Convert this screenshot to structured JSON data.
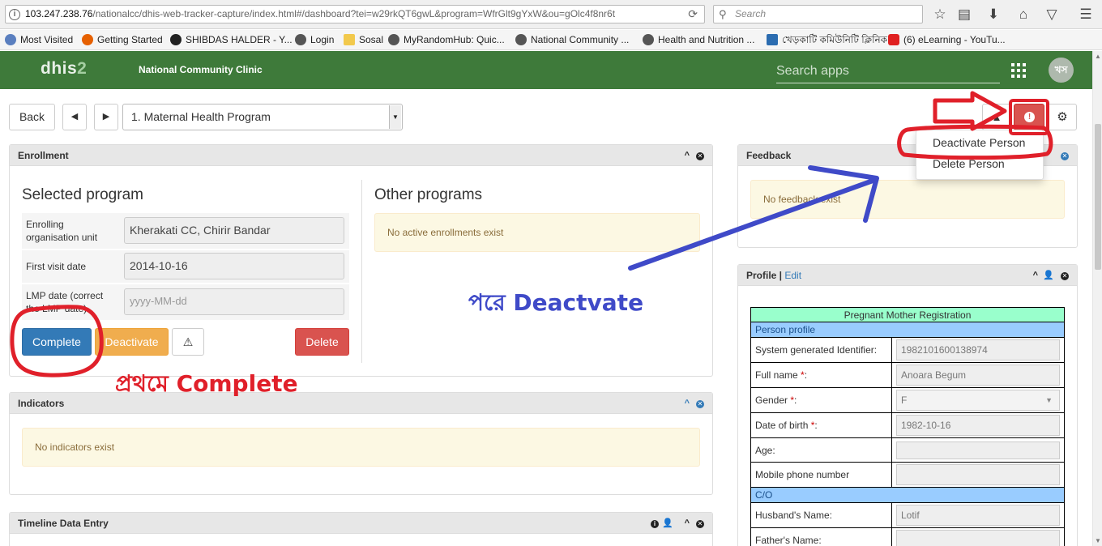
{
  "browser": {
    "url_host": "103.247.238.76",
    "url_path": "/nationalcc/dhis-web-tracker-capture/index.html#/dashboard?tei=w29rkQT6gwL&program=WfrGlt9gYxW&ou=gOlc4f8nr6t",
    "search_placeholder": "Search",
    "bookmarks": [
      {
        "label": "Most Visited",
        "icon_color": "#5a7fbf"
      },
      {
        "label": "Getting Started",
        "icon_color": "#e66000"
      },
      {
        "label": "SHIBDAS HALDER - Y...",
        "icon_color": "#222222"
      },
      {
        "label": "Login",
        "icon_color": "#555555"
      },
      {
        "label": "Sosal",
        "icon_color": "#f2c94c"
      },
      {
        "label": "MyRandomHub: Quic...",
        "icon_color": "#555555"
      },
      {
        "label": "National Community ...",
        "icon_color": "#555555"
      },
      {
        "label": "Health and Nutrition ...",
        "icon_color": "#555555"
      },
      {
        "label": "খেড়কাটি কমিউনিটি ক্লিনিক",
        "icon_color": "#2b6cb0"
      },
      {
        "label": "(6) eLearning - YouTu...",
        "icon_color": "#e02020"
      }
    ]
  },
  "header": {
    "logo_main": "dhis",
    "logo_num": "2",
    "org_name": "National Community Clinic",
    "search_placeholder": "Search apps",
    "avatar_initials": "খস",
    "color": "#3e7a3a"
  },
  "toolbar": {
    "back_label": "Back",
    "prev_glyph": "◀",
    "next_glyph": "▶",
    "program_value": "1. Maternal Health Program"
  },
  "dropdown": {
    "items": [
      "Deactivate Person",
      "Delete Person"
    ]
  },
  "enrollment": {
    "title": "Enrollment",
    "selected_heading": "Selected program",
    "other_heading": "Other programs",
    "no_enrollments": "No active enrollments exist",
    "fields": [
      {
        "label": "Enrolling organisation unit",
        "value": ""
      },
      {
        "label": "First visit date",
        "value": "2014-10-16"
      },
      {
        "label": "LMP date (correct the LMP date)",
        "value": ""
      }
    ],
    "org_value": "Kherakati CC, Chirir Bandar",
    "first_visit": "2014-10-16",
    "lmp_placeholder": "yyyy-MM-dd",
    "buttons": {
      "complete": "Complete",
      "deactivate": "Deactivate",
      "delete": "Delete"
    }
  },
  "indicators": {
    "title": "Indicators",
    "empty": "No indicators exist"
  },
  "timeline": {
    "title": "Timeline Data Entry"
  },
  "feedback": {
    "title": "Feedback",
    "empty": "No feedback exist"
  },
  "profile": {
    "title": "Profile",
    "edit_label": "Edit",
    "form_title": "Pregnant Mother Registration",
    "section_person": "Person profile",
    "section_co": "C/O",
    "rows": [
      {
        "label": "System generated Identifier:",
        "required": false,
        "value": "1982101600138974"
      },
      {
        "label": "Full name ",
        "required": true,
        "value": "Anoara Begum"
      },
      {
        "label": "Gender ",
        "required": true,
        "value": "F"
      },
      {
        "label": "Date of birth ",
        "required": true,
        "value": "1982-10-16"
      },
      {
        "label": "Age:",
        "required": false,
        "value": ""
      },
      {
        "label": "Mobile phone number",
        "required": false,
        "value": ""
      }
    ],
    "co_rows": [
      {
        "label": "Husband's Name:",
        "value": "Lotif"
      },
      {
        "label": "Father's Name:",
        "value": ""
      }
    ]
  },
  "annotations": {
    "first_bangla": "প্রথমে",
    "first_en": "Complete",
    "then_bangla": "পরে",
    "then_en": "Deactvate",
    "red": "#e0202a",
    "blue": "#3f4ac8"
  }
}
